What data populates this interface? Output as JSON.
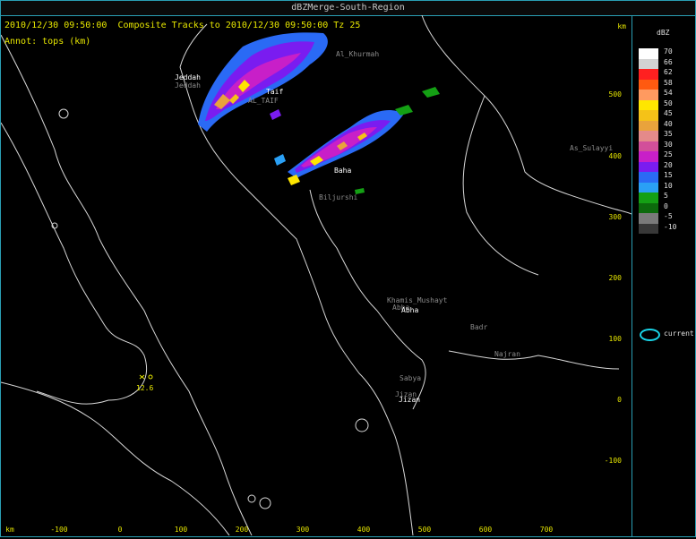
{
  "window": {
    "title": "dBZMerge-South-Region"
  },
  "header": {
    "timestamp": "2010/12/30 09:50:00",
    "subtitle": "Composite Tracks to 2010/12/30 09:50:00 Tz 25"
  },
  "annot": "Annot: tops (km)",
  "axes": {
    "unit": "km",
    "x_ticks": [
      "-100",
      "0",
      "100",
      "200",
      "300",
      "400",
      "500",
      "600",
      "700"
    ],
    "y_ticks": [
      "500",
      "400",
      "300",
      "200",
      "100",
      "0",
      "-100"
    ]
  },
  "cities": {
    "jeddah": "Jeddah",
    "taif": "Taif",
    "taif_code": "AL_TAIF",
    "baha": "Baha",
    "biljurshi": "Biljurshi",
    "khamis": "Khamis_Mushayt",
    "abha": "Abha",
    "badr": "Badr",
    "najran": "Najran",
    "sabya": "Sabya",
    "jizan": "Jizan",
    "sulayyil": "As_Sulayyi",
    "khurmah": "Al_Khurmah",
    "marker_value": "12.6"
  },
  "legend": {
    "title": "dBZ",
    "entries": [
      {
        "label": "70",
        "color": "#ffffff"
      },
      {
        "label": "66",
        "color": "#d2d2d2"
      },
      {
        "label": "62",
        "color": "#ff2020"
      },
      {
        "label": "58",
        "color": "#ff5a10"
      },
      {
        "label": "54",
        "color": "#ff9a60"
      },
      {
        "label": "50",
        "color": "#ffe600"
      },
      {
        "label": "45",
        "color": "#f5c218"
      },
      {
        "label": "40",
        "color": "#e9a33c"
      },
      {
        "label": "35",
        "color": "#e48a8a"
      },
      {
        "label": "30",
        "color": "#d24f9a"
      },
      {
        "label": "25",
        "color": "#c81fc8"
      },
      {
        "label": "20",
        "color": "#7a1cf0"
      },
      {
        "label": "15",
        "color": "#2a6af5"
      },
      {
        "label": "10",
        "color": "#2aa0f5"
      },
      {
        "label": "5",
        "color": "#14a014"
      },
      {
        "label": "0",
        "color": "#0c6a0c"
      },
      {
        "label": "-5",
        "color": "#7a7a7a"
      },
      {
        "label": "-10",
        "color": "#383838"
      }
    ],
    "current_label": "current"
  }
}
